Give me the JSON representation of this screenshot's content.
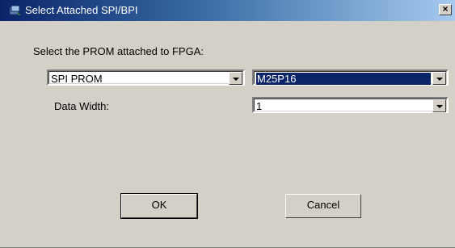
{
  "window": {
    "title": "Select Attached SPI/BPI",
    "close_glyph": "×",
    "icon": "app-icon"
  },
  "form": {
    "prompt_label": "Select the PROM attached to FPGA:",
    "prom_type": {
      "value": "SPI PROM"
    },
    "prom_device": {
      "value": "M25P16"
    },
    "data_width_label": "Data Width:",
    "data_width": {
      "value": "1"
    }
  },
  "buttons": {
    "ok_label": "OK",
    "cancel_label": "Cancel"
  },
  "colors": {
    "titlebar_start": "#0a246a",
    "titlebar_end": "#a6caf0",
    "dialog_face": "#d4d0c8",
    "selection": "#0a246a"
  }
}
